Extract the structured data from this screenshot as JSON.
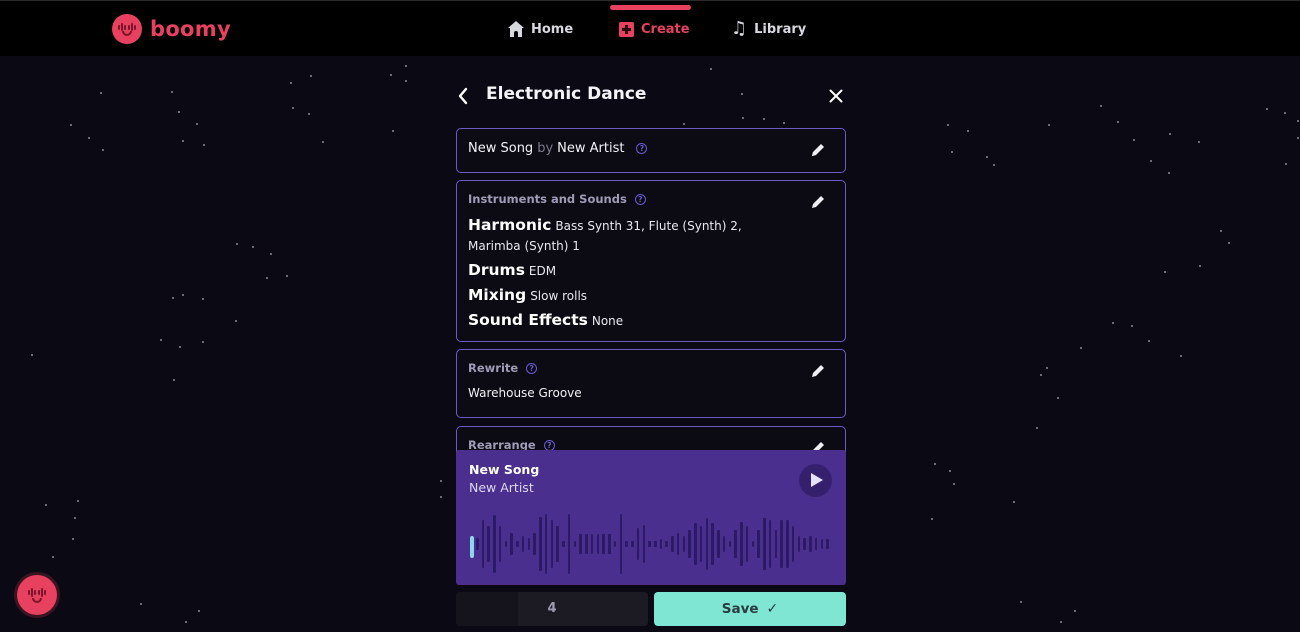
{
  "brand": {
    "name": "boomy",
    "accent": "#e8405f"
  },
  "nav": {
    "items": [
      {
        "label": "Home",
        "icon": "home-icon",
        "active": false
      },
      {
        "label": "Create",
        "icon": "plus-square-icon",
        "active": true
      },
      {
        "label": "Library",
        "icon": "music-note-icon",
        "active": false
      }
    ]
  },
  "panel": {
    "title": "Electronic Dance",
    "song": {
      "title": "New Song",
      "by": "by",
      "artist": "New Artist"
    },
    "instruments": {
      "label": "Instruments and Sounds",
      "rows": [
        {
          "key": "Harmonic",
          "value": "Bass Synth 31, Flute (Synth) 2, Marimba (Synth) 1"
        },
        {
          "key": "Drums",
          "value": "EDM"
        },
        {
          "key": "Mixing",
          "value": "Slow rolls"
        },
        {
          "key": "Sound Effects",
          "value": "None"
        }
      ]
    },
    "rewrite": {
      "label": "Rewrite",
      "value": "Warehouse Groove"
    },
    "rearrange": {
      "label": "Rearrange"
    }
  },
  "player": {
    "title": "New Song",
    "artist": "New Artist",
    "progress": 0.0,
    "waveform": [
      0.2,
      0.75,
      0.55,
      0.92,
      0.55,
      0.08,
      0.35,
      0.1,
      0.25,
      0.2,
      0.35,
      0.85,
      0.95,
      0.75,
      0.55,
      0.08,
      0.95,
      0.08,
      0.3,
      0.3,
      0.3,
      0.3,
      0.3,
      0.3,
      0.08,
      0.95,
      0.08,
      0.08,
      0.5,
      0.6,
      0.08,
      0.08,
      0.15,
      0.08,
      0.25,
      0.35,
      0.25,
      0.45,
      0.65,
      0.55,
      0.8,
      0.65,
      0.45,
      0.25,
      0.08,
      0.45,
      0.7,
      0.55,
      0.08,
      0.45,
      0.8,
      0.75,
      0.45,
      0.75,
      0.75,
      0.55,
      0.25,
      0.2,
      0.25,
      0.2,
      0.15,
      0.15
    ]
  },
  "footer": {
    "count": "4",
    "save_label": "Save",
    "save_color": "#7fe6d4"
  }
}
